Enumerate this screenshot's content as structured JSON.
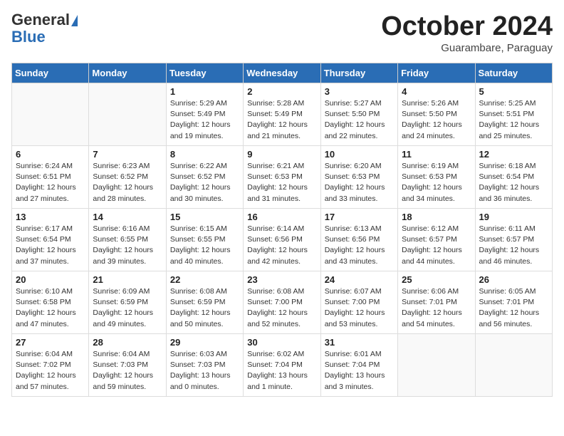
{
  "header": {
    "logo_line1": "General",
    "logo_line2": "Blue",
    "month": "October 2024",
    "location": "Guarambare, Paraguay"
  },
  "days_of_week": [
    "Sunday",
    "Monday",
    "Tuesday",
    "Wednesday",
    "Thursday",
    "Friday",
    "Saturday"
  ],
  "weeks": [
    [
      {
        "day": "",
        "info": ""
      },
      {
        "day": "",
        "info": ""
      },
      {
        "day": "1",
        "info": "Sunrise: 5:29 AM\nSunset: 5:49 PM\nDaylight: 12 hours and 19 minutes."
      },
      {
        "day": "2",
        "info": "Sunrise: 5:28 AM\nSunset: 5:49 PM\nDaylight: 12 hours and 21 minutes."
      },
      {
        "day": "3",
        "info": "Sunrise: 5:27 AM\nSunset: 5:50 PM\nDaylight: 12 hours and 22 minutes."
      },
      {
        "day": "4",
        "info": "Sunrise: 5:26 AM\nSunset: 5:50 PM\nDaylight: 12 hours and 24 minutes."
      },
      {
        "day": "5",
        "info": "Sunrise: 5:25 AM\nSunset: 5:51 PM\nDaylight: 12 hours and 25 minutes."
      }
    ],
    [
      {
        "day": "6",
        "info": "Sunrise: 6:24 AM\nSunset: 6:51 PM\nDaylight: 12 hours and 27 minutes."
      },
      {
        "day": "7",
        "info": "Sunrise: 6:23 AM\nSunset: 6:52 PM\nDaylight: 12 hours and 28 minutes."
      },
      {
        "day": "8",
        "info": "Sunrise: 6:22 AM\nSunset: 6:52 PM\nDaylight: 12 hours and 30 minutes."
      },
      {
        "day": "9",
        "info": "Sunrise: 6:21 AM\nSunset: 6:53 PM\nDaylight: 12 hours and 31 minutes."
      },
      {
        "day": "10",
        "info": "Sunrise: 6:20 AM\nSunset: 6:53 PM\nDaylight: 12 hours and 33 minutes."
      },
      {
        "day": "11",
        "info": "Sunrise: 6:19 AM\nSunset: 6:53 PM\nDaylight: 12 hours and 34 minutes."
      },
      {
        "day": "12",
        "info": "Sunrise: 6:18 AM\nSunset: 6:54 PM\nDaylight: 12 hours and 36 minutes."
      }
    ],
    [
      {
        "day": "13",
        "info": "Sunrise: 6:17 AM\nSunset: 6:54 PM\nDaylight: 12 hours and 37 minutes."
      },
      {
        "day": "14",
        "info": "Sunrise: 6:16 AM\nSunset: 6:55 PM\nDaylight: 12 hours and 39 minutes."
      },
      {
        "day": "15",
        "info": "Sunrise: 6:15 AM\nSunset: 6:55 PM\nDaylight: 12 hours and 40 minutes."
      },
      {
        "day": "16",
        "info": "Sunrise: 6:14 AM\nSunset: 6:56 PM\nDaylight: 12 hours and 42 minutes."
      },
      {
        "day": "17",
        "info": "Sunrise: 6:13 AM\nSunset: 6:56 PM\nDaylight: 12 hours and 43 minutes."
      },
      {
        "day": "18",
        "info": "Sunrise: 6:12 AM\nSunset: 6:57 PM\nDaylight: 12 hours and 44 minutes."
      },
      {
        "day": "19",
        "info": "Sunrise: 6:11 AM\nSunset: 6:57 PM\nDaylight: 12 hours and 46 minutes."
      }
    ],
    [
      {
        "day": "20",
        "info": "Sunrise: 6:10 AM\nSunset: 6:58 PM\nDaylight: 12 hours and 47 minutes."
      },
      {
        "day": "21",
        "info": "Sunrise: 6:09 AM\nSunset: 6:59 PM\nDaylight: 12 hours and 49 minutes."
      },
      {
        "day": "22",
        "info": "Sunrise: 6:08 AM\nSunset: 6:59 PM\nDaylight: 12 hours and 50 minutes."
      },
      {
        "day": "23",
        "info": "Sunrise: 6:08 AM\nSunset: 7:00 PM\nDaylight: 12 hours and 52 minutes."
      },
      {
        "day": "24",
        "info": "Sunrise: 6:07 AM\nSunset: 7:00 PM\nDaylight: 12 hours and 53 minutes."
      },
      {
        "day": "25",
        "info": "Sunrise: 6:06 AM\nSunset: 7:01 PM\nDaylight: 12 hours and 54 minutes."
      },
      {
        "day": "26",
        "info": "Sunrise: 6:05 AM\nSunset: 7:01 PM\nDaylight: 12 hours and 56 minutes."
      }
    ],
    [
      {
        "day": "27",
        "info": "Sunrise: 6:04 AM\nSunset: 7:02 PM\nDaylight: 12 hours and 57 minutes."
      },
      {
        "day": "28",
        "info": "Sunrise: 6:04 AM\nSunset: 7:03 PM\nDaylight: 12 hours and 59 minutes."
      },
      {
        "day": "29",
        "info": "Sunrise: 6:03 AM\nSunset: 7:03 PM\nDaylight: 13 hours and 0 minutes."
      },
      {
        "day": "30",
        "info": "Sunrise: 6:02 AM\nSunset: 7:04 PM\nDaylight: 13 hours and 1 minute."
      },
      {
        "day": "31",
        "info": "Sunrise: 6:01 AM\nSunset: 7:04 PM\nDaylight: 13 hours and 3 minutes."
      },
      {
        "day": "",
        "info": ""
      },
      {
        "day": "",
        "info": ""
      }
    ]
  ]
}
